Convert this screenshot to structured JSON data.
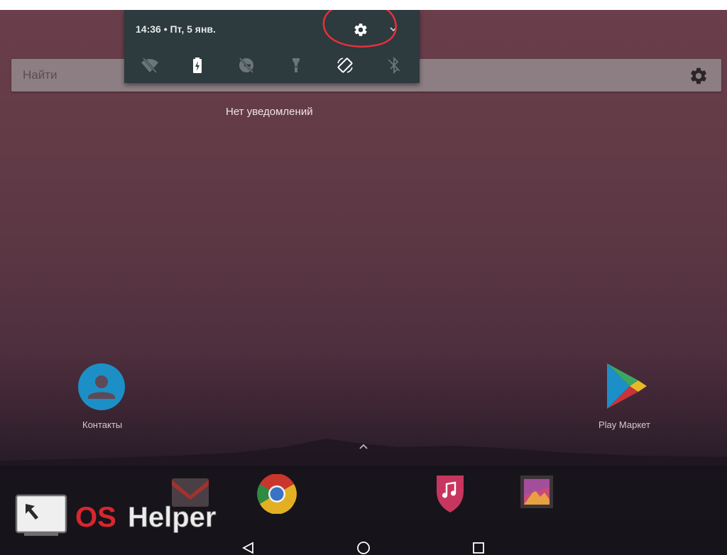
{
  "status": {
    "time_date": "14:36 • Пт, 5 янв."
  },
  "search": {
    "placeholder": "Найти"
  },
  "notifications": {
    "empty_text": "Нет уведомлений"
  },
  "quick_settings": [
    {
      "name": "wifi-off-icon"
    },
    {
      "name": "battery-charging-icon"
    },
    {
      "name": "do-not-disturb-off-icon"
    },
    {
      "name": "flashlight-icon"
    },
    {
      "name": "auto-rotate-icon"
    },
    {
      "name": "bluetooth-off-icon"
    }
  ],
  "apps": [
    {
      "label": "Контакты",
      "icon": "contacts-icon"
    },
    {
      "label": "Play Маркет",
      "icon": "play-store-icon"
    }
  ],
  "dock": [
    "gmail-icon",
    "chrome-icon",
    "music-icon",
    "gallery-icon"
  ],
  "watermark": {
    "text": "OS Helper"
  },
  "colors": {
    "shade_bg": "#2d3a3e",
    "annotation_red": "#e8303a",
    "watermark_red": "#d9262e"
  }
}
